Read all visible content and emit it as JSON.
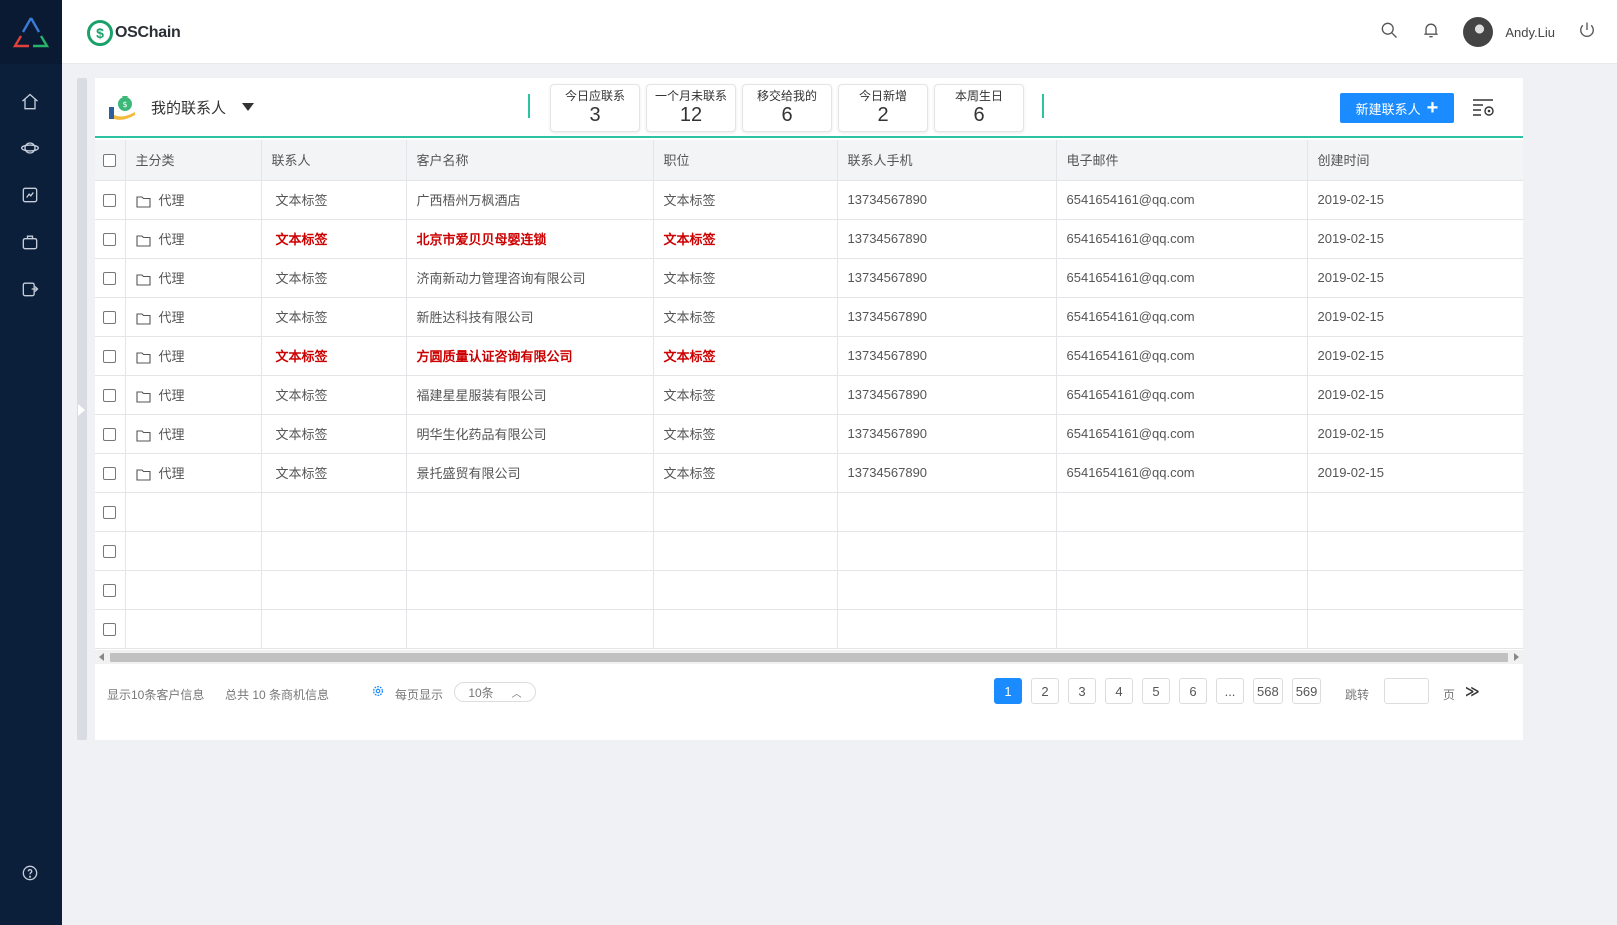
{
  "header": {
    "brand": "OSChain",
    "user_name": "Andy.Liu"
  },
  "panel": {
    "title": "我的联系人",
    "stats": [
      {
        "label": "今日应联系",
        "value": "3"
      },
      {
        "label": "一个月未联系",
        "value": "12"
      },
      {
        "label": "移交给我的",
        "value": "6"
      },
      {
        "label": "今日新增",
        "value": "2"
      },
      {
        "label": "本周生日",
        "value": "6"
      }
    ],
    "new_button": "新建联系人"
  },
  "table": {
    "columns": [
      "主分类",
      "联系人",
      "客户名称",
      "职位",
      "联系人手机",
      "电子邮件",
      "创建时间"
    ],
    "rows": [
      {
        "category": "代理",
        "contact": "文本标签",
        "customer": "广西梧州万枫酒店",
        "position": "文本标签",
        "phone": "13734567890",
        "email": "6541654161@qq.com",
        "created": "2019-02-15",
        "highlight": false
      },
      {
        "category": "代理",
        "contact": "文本标签",
        "customer": "北京市爱贝贝母婴连锁",
        "position": "文本标签",
        "phone": "13734567890",
        "email": "6541654161@qq.com",
        "created": "2019-02-15",
        "highlight": true
      },
      {
        "category": "代理",
        "contact": "文本标签",
        "customer": "济南新动力管理咨询有限公司",
        "position": "文本标签",
        "phone": "13734567890",
        "email": "6541654161@qq.com",
        "created": "2019-02-15",
        "highlight": false
      },
      {
        "category": "代理",
        "contact": "文本标签",
        "customer": "新胜达科技有限公司",
        "position": "文本标签",
        "phone": "13734567890",
        "email": "6541654161@qq.com",
        "created": "2019-02-15",
        "highlight": false
      },
      {
        "category": "代理",
        "contact": "文本标签",
        "customer": "方圆质量认证咨询有限公司",
        "position": "文本标签",
        "phone": "13734567890",
        "email": "6541654161@qq.com",
        "created": "2019-02-15",
        "highlight": true
      },
      {
        "category": "代理",
        "contact": "文本标签",
        "customer": "福建星星服装有限公司",
        "position": "文本标签",
        "phone": "13734567890",
        "email": "6541654161@qq.com",
        "created": "2019-02-15",
        "highlight": false
      },
      {
        "category": "代理",
        "contact": "文本标签",
        "customer": "明华生化药品有限公司",
        "position": "文本标签",
        "phone": "13734567890",
        "email": "6541654161@qq.com",
        "created": "2019-02-15",
        "highlight": false
      },
      {
        "category": "代理",
        "contact": "文本标签",
        "customer": "景托盛贸有限公司",
        "position": "文本标签",
        "phone": "13734567890",
        "email": "6541654161@qq.com",
        "created": "2019-02-15",
        "highlight": false
      }
    ],
    "empty_rows": 4
  },
  "footer": {
    "shown_info": "显示10条客户信息",
    "total_info": "总共 10 条商机信息",
    "per_page_label": "每页显示",
    "per_page_value": "10条",
    "pages": [
      "1",
      "2",
      "3",
      "4",
      "5",
      "6",
      "...",
      "568",
      "569"
    ],
    "current_page": "1",
    "jump_label": "跳转",
    "page_unit": "页",
    "jump_go": "≫"
  },
  "colors": {
    "sidebar": "#0b1e3a",
    "accent_teal": "#2bc3a1",
    "primary_blue": "#1a8cff",
    "highlight_red": "#cc0000"
  },
  "icons": {
    "sidebar": [
      "home-icon",
      "planet-icon",
      "report-icon",
      "bag-icon",
      "export-icon",
      "help-icon"
    ],
    "header": [
      "search-icon",
      "bell-icon",
      "power-icon"
    ]
  }
}
